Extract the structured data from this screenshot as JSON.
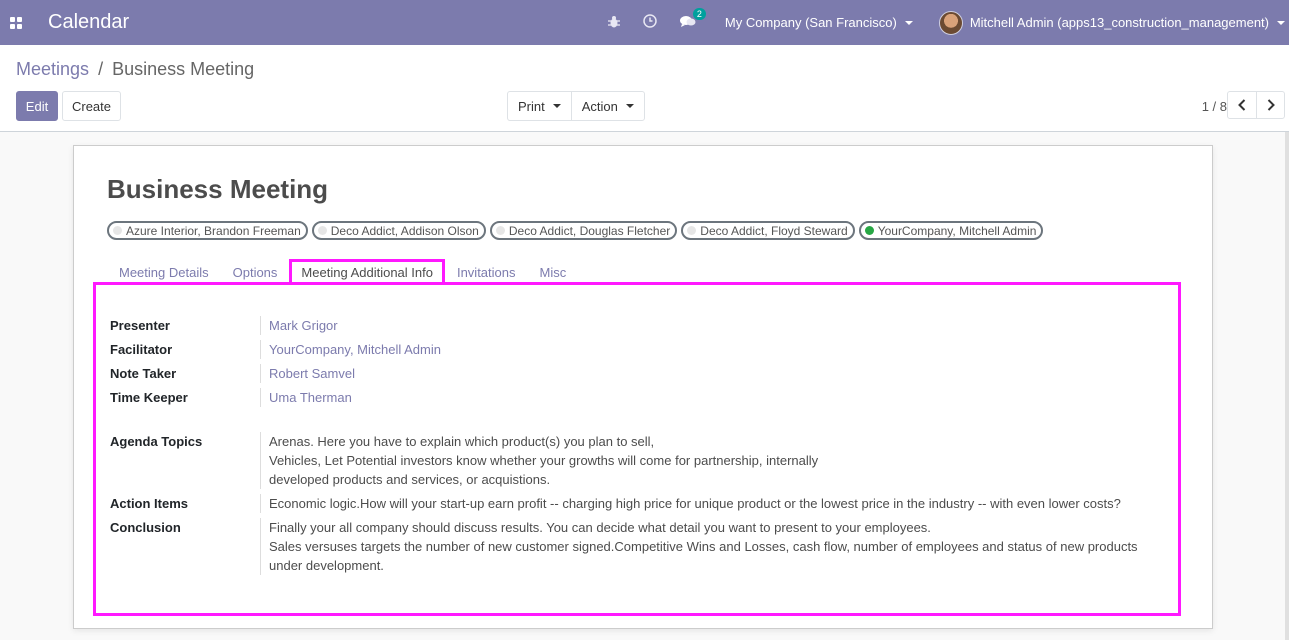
{
  "navbar": {
    "app_title": "Calendar",
    "company": "My Company (San Francisco)",
    "user": "Mitchell Admin (apps13_construction_management)",
    "messages_count": "2",
    "icons": [
      "apps-icon",
      "bug-icon",
      "clock-icon",
      "chat-icon"
    ],
    "color": "#7c7bad"
  },
  "breadcrumb": {
    "parent": "Meetings",
    "separator": "/",
    "current": "Business Meeting"
  },
  "toolbar": {
    "edit_label": "Edit",
    "create_label": "Create",
    "print_label": "Print",
    "action_label": "Action"
  },
  "pager": {
    "value": "1 / 8"
  },
  "record": {
    "title": "Business Meeting",
    "attendees": [
      {
        "label": "Azure Interior, Brandon Freeman",
        "online": false
      },
      {
        "label": "Deco Addict, Addison Olson",
        "online": false
      },
      {
        "label": "Deco Addict, Douglas Fletcher",
        "online": false
      },
      {
        "label": "Deco Addict, Floyd Steward",
        "online": false
      },
      {
        "label": "YourCompany, Mitchell Admin",
        "online": true
      }
    ]
  },
  "tabs": [
    {
      "label": "Meeting Details",
      "active": false
    },
    {
      "label": "Options",
      "active": false
    },
    {
      "label": "Meeting Additional Info",
      "active": true
    },
    {
      "label": "Invitations",
      "active": false
    },
    {
      "label": "Misc",
      "active": false
    }
  ],
  "fields": {
    "presenter": {
      "label": "Presenter",
      "value": "Mark Grigor"
    },
    "facilitator": {
      "label": "Facilitator",
      "value": "YourCompany, Mitchell Admin"
    },
    "note_taker": {
      "label": "Note Taker",
      "value": "Robert Samvel"
    },
    "time_keeper": {
      "label": "Time Keeper",
      "value": "Uma Therman"
    },
    "agenda_topics": {
      "label": "Agenda Topics",
      "lines": [
        "Arenas. Here you have to explain which product(s) you plan to sell,",
        "Vehicles, Let Potential investors know whether your growths will come for partnership, internally",
        "developed products and services, or acquistions."
      ]
    },
    "action_items": {
      "label": "Action Items",
      "value": "Economic logic.How will your start-up earn profit -- charging high price for unique product or the lowest price in the industry -- with even lower costs?"
    },
    "conclusion": {
      "label": "Conclusion",
      "lines": [
        "Finally your all company should discuss results. You can decide what detail you want to present to your employees.",
        "Sales versuses targets the number of new customer signed.Competitive Wins and Losses, cash flow, number of employees and  status of new products",
        "under development."
      ]
    }
  },
  "highlight_color": "#ff18ff"
}
